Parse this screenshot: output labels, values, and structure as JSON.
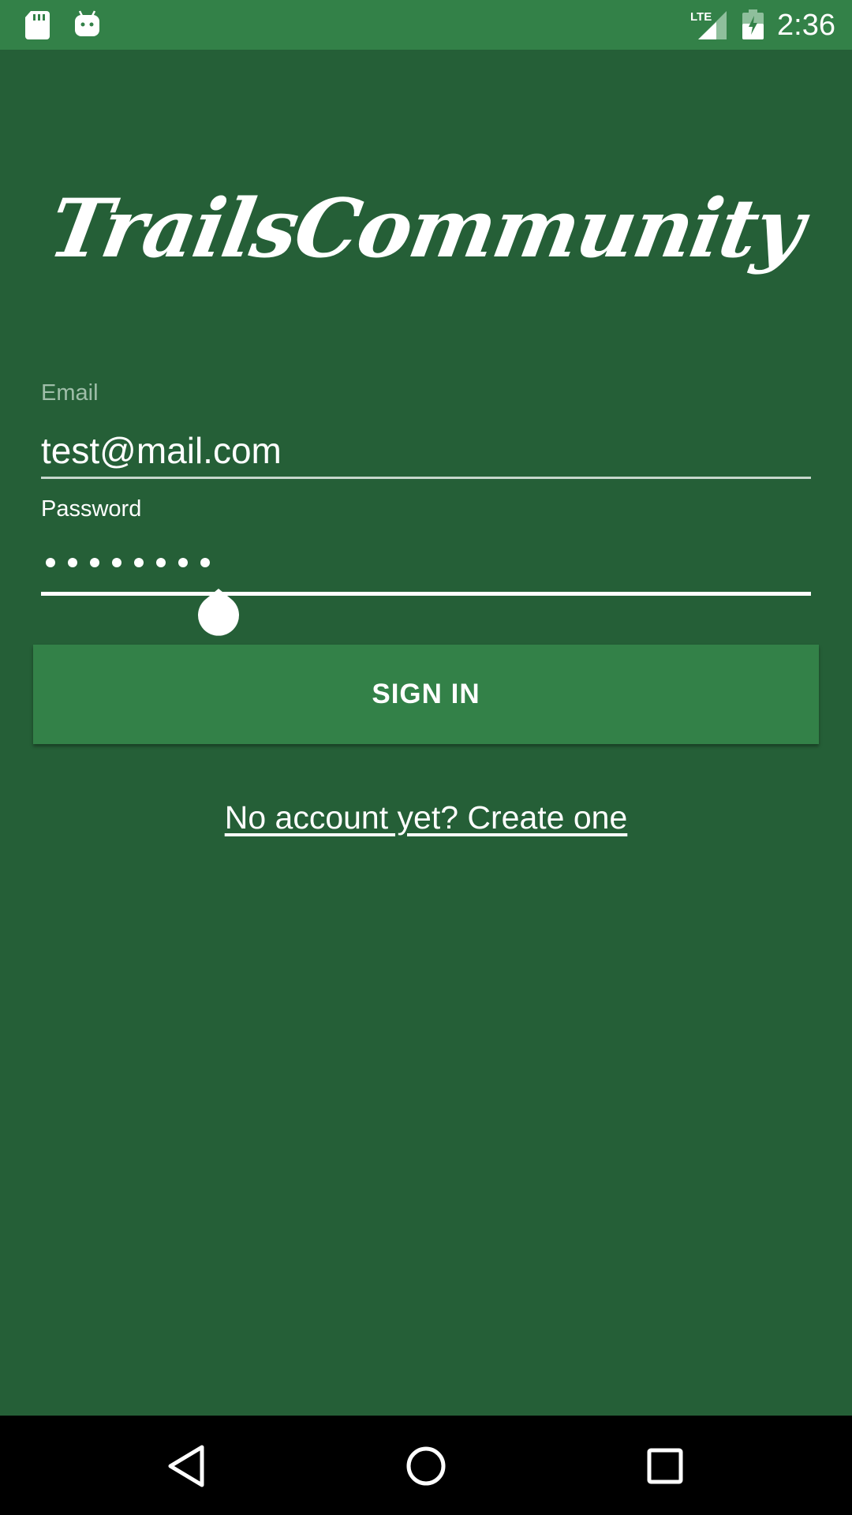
{
  "status_bar": {
    "time": "2:36",
    "icons": [
      "sd-card-icon",
      "android-icon",
      "lte-signal-icon",
      "battery-icon"
    ],
    "lte_label": "LTE"
  },
  "logo": {
    "text": "TrailsCommunity"
  },
  "email": {
    "label": "Email",
    "value": "test@mail.com"
  },
  "password": {
    "label": "Password",
    "masked_length": 8
  },
  "sign_in": {
    "label": "SIGN IN"
  },
  "create_account": {
    "label": "No account yet? Create one"
  },
  "nav": {
    "icons": [
      "back-icon",
      "home-icon",
      "recents-icon"
    ]
  },
  "colors": {
    "background": "#255f37",
    "status_bar": "#338148",
    "button": "#338148",
    "nav_bar": "#000000"
  }
}
